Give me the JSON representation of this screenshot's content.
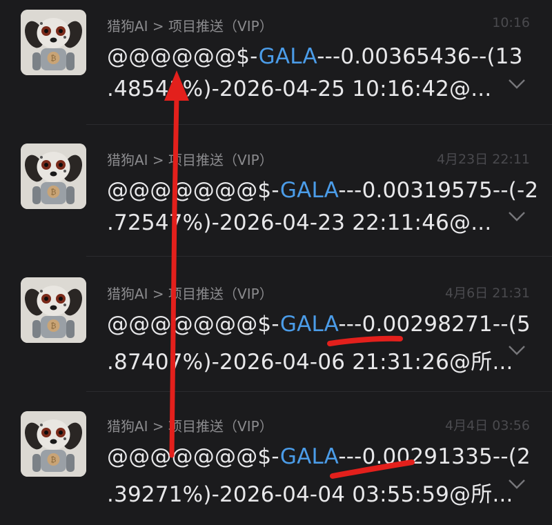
{
  "colors": {
    "background": "#1b1b1d",
    "text": "#e8e8ea",
    "meta": "#8b8b8e",
    "coin_link": "#4b9ce8",
    "annotation_red": "#e3201c"
  },
  "messages": [
    {
      "sender": "猎狗AI > 项目推送（VIP）",
      "time": "10:16",
      "prefix": "@@@@@@$-",
      "coin": "GALA",
      "line1_rest": "---0.00365436--(13",
      "line2": ".48541%)-2026-04-25 10:16:42@..."
    },
    {
      "sender": "猎狗AI > 项目推送（VIP）",
      "time": "4月23日 22:11",
      "prefix": "@@@@@@@$-",
      "coin": "GALA",
      "line1_rest": "---0.00319575--(-2",
      "line2": ".72547%)-2026-04-23 22:11:46@..."
    },
    {
      "sender": "猎狗AI > 项目推送（VIP）",
      "time": "4月6日 21:31",
      "prefix": "@@@@@@@$-",
      "coin": "GALA",
      "line1_rest": "---0.00298271--(5",
      "line2": ".87407%)-2026-04-06 21:31:26@所..."
    },
    {
      "sender": "猎狗AI > 项目推送（VIP）",
      "time": "4月4日 03:56",
      "prefix": "@@@@@@@$-",
      "coin": "GALA",
      "line1_rest": "---0.00291335--(2",
      "line2": ".39271%)-2026-04-04 03:55:59@所..."
    }
  ],
  "icons": {
    "avatar": "robot-dalmatian-dog-avatar-icon",
    "expand": "chevron-down-icon"
  }
}
